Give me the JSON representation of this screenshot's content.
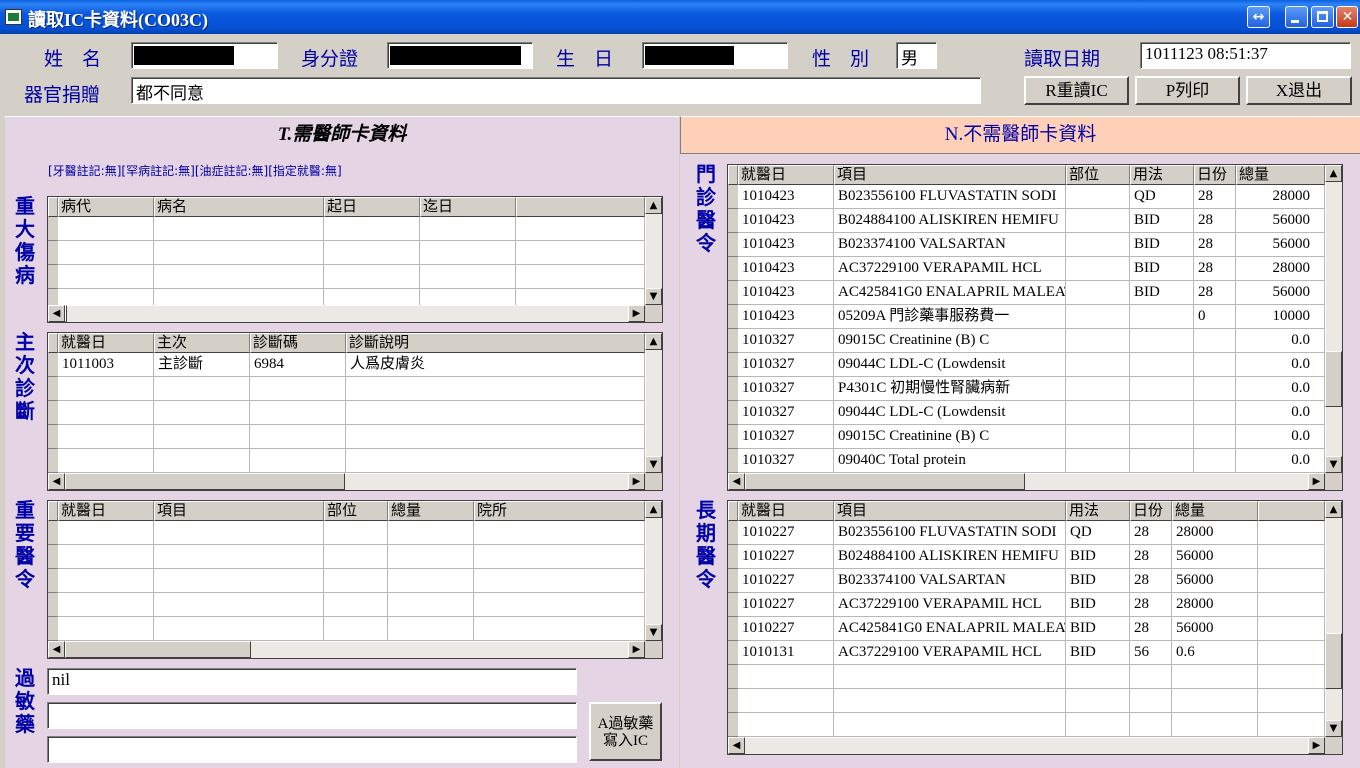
{
  "window": {
    "title": "讀取IC卡資料(CO03C)",
    "restore_glyph": "↔",
    "close_glyph": "✕"
  },
  "header": {
    "name_label": "姓　名",
    "id_label": "身分證",
    "birth_label": "生　日",
    "sex_label": "性　別",
    "sex_value": "男",
    "read_date_label": "讀取日期",
    "read_date_value": "1011123 08:51:37",
    "organ_label": "器官捐贈",
    "organ_value": "都不同意",
    "reread_button": "R重讀IC",
    "print_button": "P列印",
    "exit_button": "X退出"
  },
  "tabs": {
    "doctor": "T.需醫師卡資料",
    "no_doctor": "N.不需醫師卡資料"
  },
  "flags_text": "[牙醫註記:無][罕病註記:無][油症註記:無][指定就醫:無]",
  "major_illness": {
    "label": "重大傷病",
    "headers": [
      "病代",
      "病名",
      "起日",
      "迄日",
      ""
    ],
    "rows": []
  },
  "diagnosis": {
    "label": "主次診斷",
    "headers": [
      "就醫日",
      "主次",
      "診斷碼",
      "診斷說明"
    ],
    "rows": [
      [
        "1011003",
        "主診斷",
        "6984",
        "人爲皮膚炎"
      ]
    ]
  },
  "important_orders": {
    "label": "重要醫令",
    "headers": [
      "就醫日",
      "項目",
      "部位",
      "總量",
      "院所"
    ],
    "rows": []
  },
  "allergy": {
    "label": "過敏藥",
    "lines": [
      "nil",
      "",
      ""
    ],
    "write_button_line1": "A過敏藥",
    "write_button_line2": "寫入IC"
  },
  "outpatient_orders": {
    "label": "門診醫令",
    "headers": [
      "就醫日",
      "項目",
      "部位",
      "用法",
      "日份",
      "總量"
    ],
    "rows": [
      [
        "1010423",
        "B023556100 FLUVASTATIN SODI",
        "",
        "QD",
        "28",
        "28000"
      ],
      [
        "1010423",
        "B024884100 ALISKIREN HEMIFU",
        "",
        "BID",
        "28",
        "56000"
      ],
      [
        "1010423",
        "B023374100 VALSARTAN",
        "",
        "BID",
        "28",
        "56000"
      ],
      [
        "1010423",
        "AC37229100 VERAPAMIL HCL",
        "",
        "BID",
        "28",
        "28000"
      ],
      [
        "1010423",
        "AC425841G0 ENALAPRIL MALEAT",
        "",
        "BID",
        "28",
        "56000"
      ],
      [
        "1010423",
        "05209A 門診藥事服務費一",
        "",
        "",
        "0",
        "10000"
      ],
      [
        "1010327",
        "09015C Creatinine (B) C",
        "",
        "",
        "",
        "0.0"
      ],
      [
        "1010327",
        "09044C LDL-C (Lowdensit",
        "",
        "",
        "",
        "0.0"
      ],
      [
        "1010327",
        "P4301C 初期慢性腎臟病新",
        "",
        "",
        "",
        "0.0"
      ],
      [
        "1010327",
        "09044C LDL-C (Lowdensit",
        "",
        "",
        "",
        "0.0"
      ],
      [
        "1010327",
        "09015C Creatinine (B) C",
        "",
        "",
        "",
        "0.0"
      ],
      [
        "1010327",
        "09040C Total protein",
        "",
        "",
        "",
        "0.0"
      ]
    ]
  },
  "long_term_orders": {
    "label": "長期醫令",
    "headers": [
      "就醫日",
      "項目",
      "用法",
      "日份",
      "總量",
      ""
    ],
    "rows": [
      [
        "1010227",
        "B023556100 FLUVASTATIN SODI",
        "QD",
        "28",
        "28000"
      ],
      [
        "1010227",
        "B024884100 ALISKIREN HEMIFU",
        "BID",
        "28",
        "56000"
      ],
      [
        "1010227",
        "B023374100 VALSARTAN",
        "BID",
        "28",
        "56000"
      ],
      [
        "1010227",
        "AC37229100 VERAPAMIL HCL",
        "BID",
        "28",
        "28000"
      ],
      [
        "1010227",
        "AC425841G0 ENALAPRIL MALEAT",
        "BID",
        "28",
        "56000"
      ],
      [
        "1010131",
        "AC37229100 VERAPAMIL HCL",
        "BID",
        "56",
        "0.6"
      ]
    ]
  },
  "colors": {
    "label_blue": "#0000a8",
    "panel_lilac": "#e4d4e4",
    "tab_peach": "#ffd0b8",
    "titlebar_blue": "#0b59de"
  }
}
